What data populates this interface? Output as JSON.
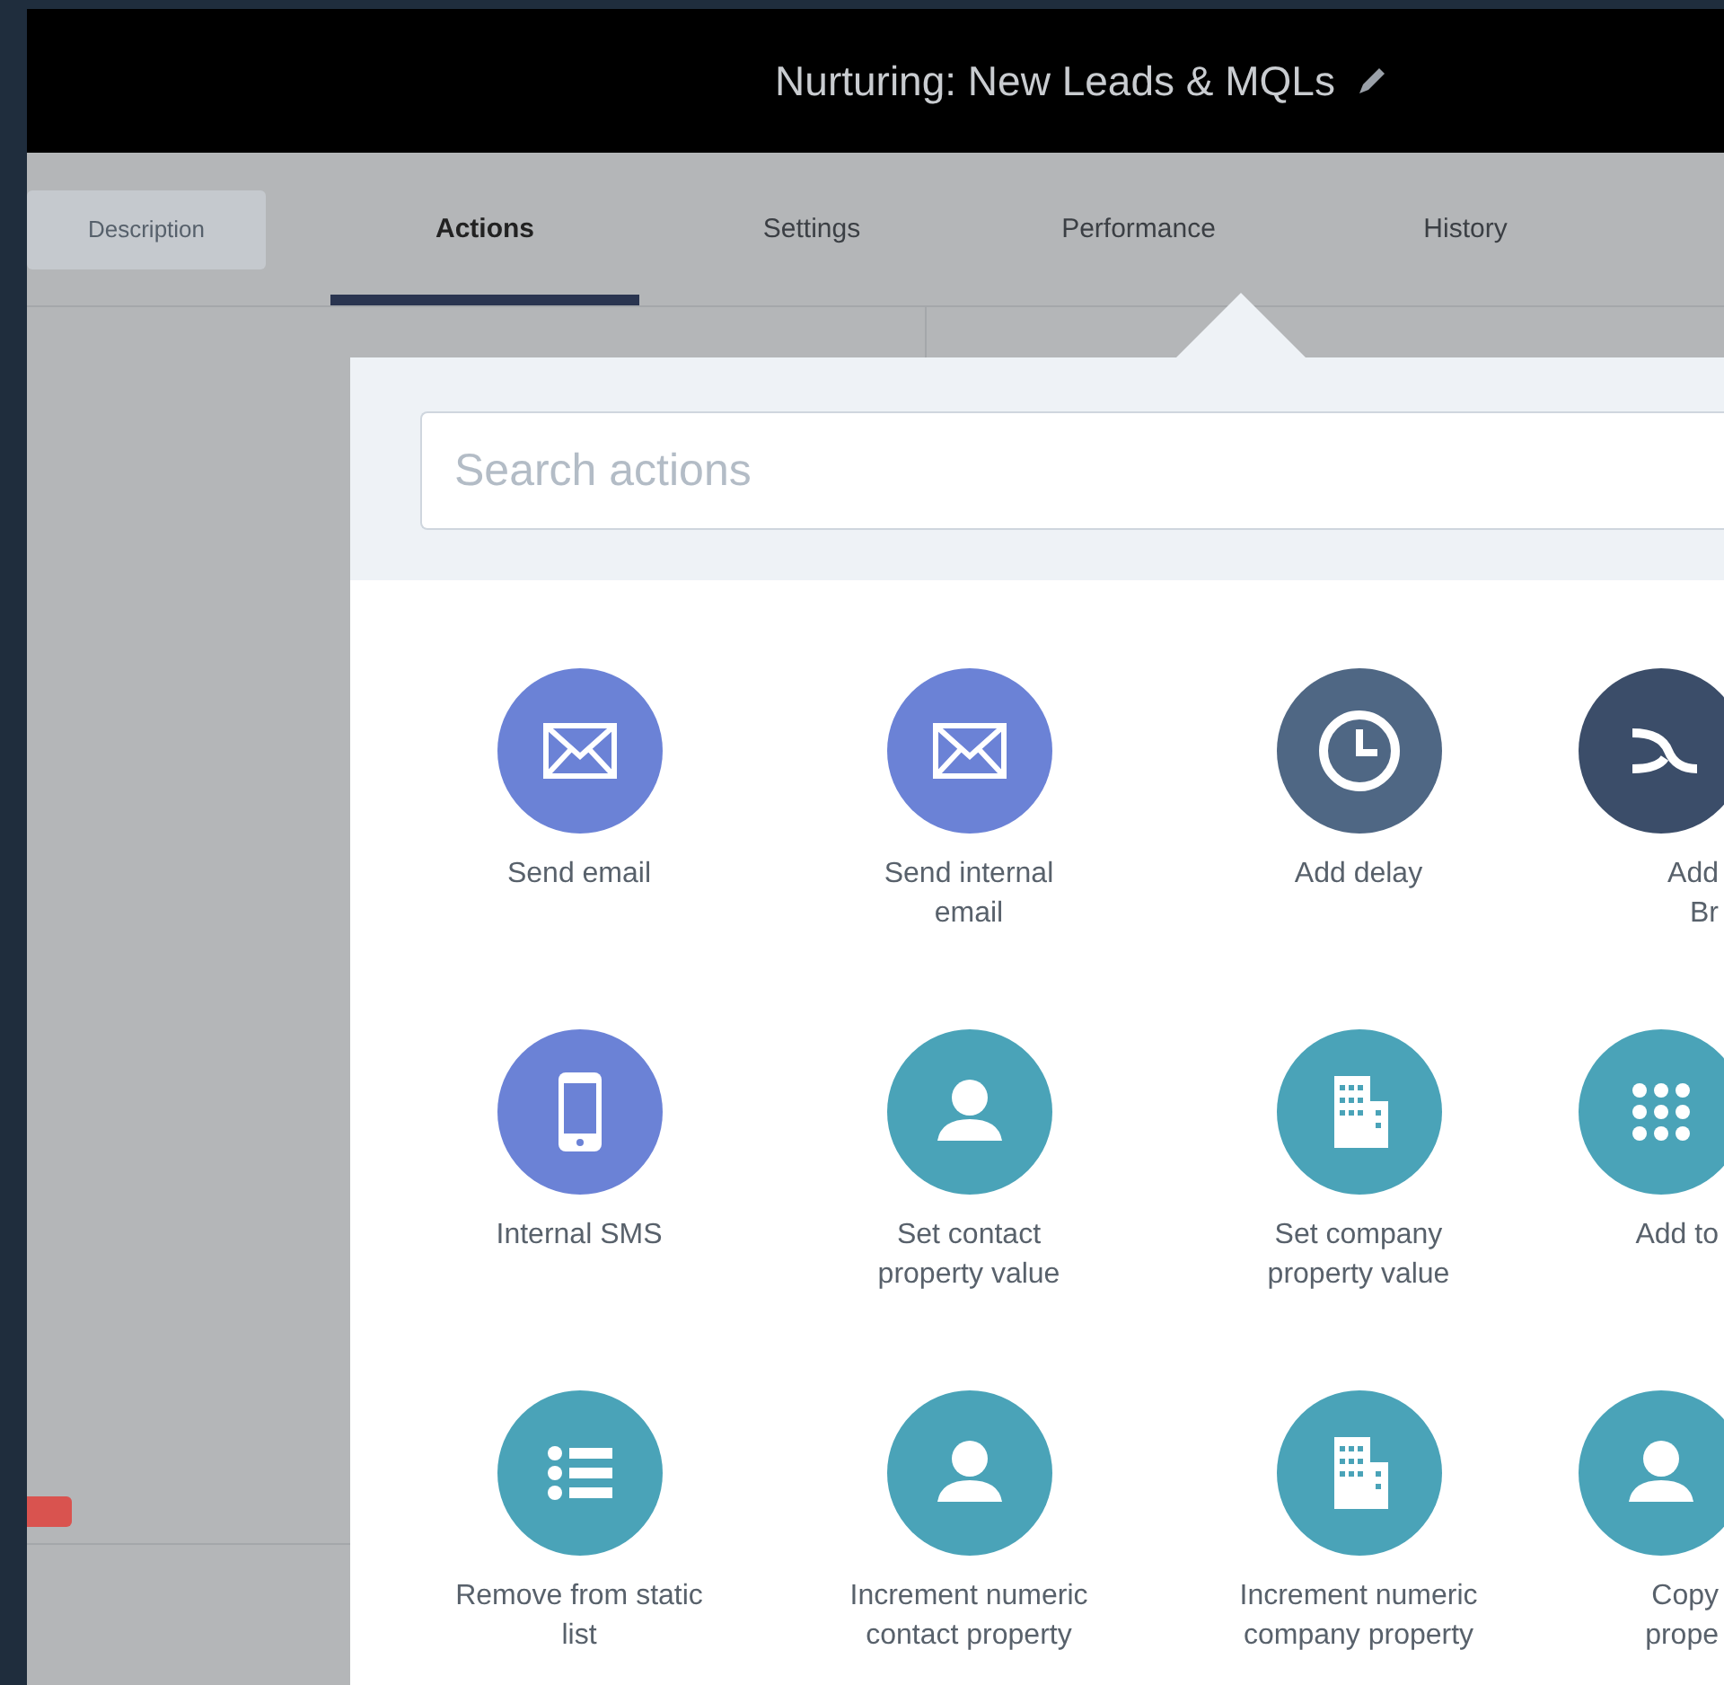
{
  "window": {
    "title": "Nurturing: New Leads & MQLs"
  },
  "tabs": [
    {
      "label": "Description",
      "kind": "pill",
      "selected": false
    },
    {
      "label": "Actions",
      "kind": "tab",
      "selected": true
    },
    {
      "label": "Settings",
      "kind": "tab",
      "selected": false
    },
    {
      "label": "Performance",
      "kind": "tab",
      "selected": false
    },
    {
      "label": "History",
      "kind": "tab",
      "selected": false
    }
  ],
  "search": {
    "placeholder": "Search actions"
  },
  "actions": [
    {
      "kind": "envelope",
      "color": "#6b82d6",
      "lines": [
        "Send email"
      ]
    },
    {
      "kind": "envelope",
      "color": "#6b82d6",
      "lines": [
        "Send internal",
        "email"
      ]
    },
    {
      "kind": "clock",
      "color": "#4f6784",
      "lines": [
        "Add delay"
      ]
    },
    {
      "kind": "branch",
      "color": "#3b4d69",
      "lines": [
        "Add",
        "Br"
      ]
    },
    {
      "kind": "phone",
      "color": "#6b82d6",
      "lines": [
        "Internal SMS"
      ]
    },
    {
      "kind": "person",
      "color": "#4aa3b8",
      "lines": [
        "Set contact",
        "property value"
      ]
    },
    {
      "kind": "building",
      "color": "#4aa3b8",
      "lines": [
        "Set company",
        "property value"
      ]
    },
    {
      "kind": "dots",
      "color": "#4aa3b8",
      "lines": [
        "Add to"
      ]
    },
    {
      "kind": "list",
      "color": "#4aa3b8",
      "lines": [
        "Remove from static",
        "list"
      ]
    },
    {
      "kind": "person",
      "color": "#4aa3b8",
      "lines": [
        "Increment numeric",
        "contact property"
      ]
    },
    {
      "kind": "building",
      "color": "#4aa3b8",
      "lines": [
        "Increment numeric",
        "company property"
      ]
    },
    {
      "kind": "person",
      "color": "#4aa3b8",
      "lines": [
        "Copy",
        "prope"
      ]
    }
  ]
}
